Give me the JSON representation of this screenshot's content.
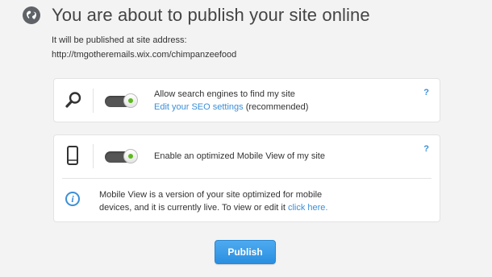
{
  "header": {
    "title": "You are about to publish your site online",
    "icon": "globe-icon"
  },
  "address": {
    "label": "It will be published at site address:",
    "url": "http://tmgotheremails.wix.com/chimpanzeefood"
  },
  "seo_card": {
    "icon": "search-icon",
    "toggle_on": true,
    "title": "Allow search engines to find my site",
    "link_text": "Edit your SEO settings",
    "suffix": "(recommended)",
    "help": "?"
  },
  "mobile_card": {
    "icon": "mobile-phone-icon",
    "toggle_on": true,
    "title": "Enable an optimized Mobile View of my site",
    "help": "?",
    "info_icon": "info-icon",
    "info_line1": "Mobile View is a version of your site optimized for mobile",
    "info_line2": "devices, and it is currently live. To view or edit it",
    "info_link": "click here."
  },
  "publish_button": {
    "label": "Publish"
  },
  "colors": {
    "accent": "#3a8fd9",
    "toggle_dot": "#5db81f",
    "button": "#2a8fe0",
    "background": "#f3f3f3"
  }
}
